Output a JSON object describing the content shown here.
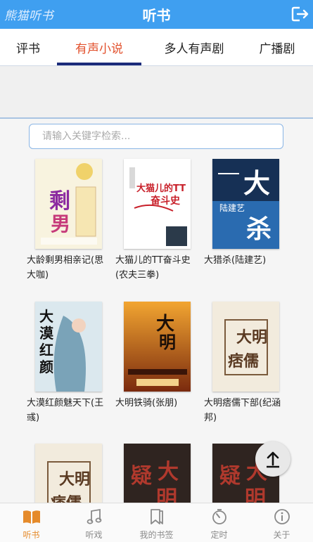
{
  "header": {
    "brand": "熊猫听书",
    "title": "听书"
  },
  "tabs": [
    {
      "label": "评书",
      "active": false
    },
    {
      "label": "有声小说",
      "active": true
    },
    {
      "label": "多人有声剧",
      "active": false
    },
    {
      "label": "广播剧",
      "active": false
    }
  ],
  "search": {
    "placeholder": "请输入关键字检索..."
  },
  "books": [
    {
      "title": "大龄剩男相亲记(思大咖)",
      "cover_text": "剩男",
      "cover_bg": "#f7f1dc"
    },
    {
      "title": "大猫儿的TT奋斗史(农夫三拳)",
      "cover_text": "大猫儿的TT奋斗史",
      "cover_bg": "#ffffff"
    },
    {
      "title": "大猎杀(陆建艺)",
      "cover_text": "大猎杀",
      "cover_bg": "#1d3f6e"
    },
    {
      "title": "大漠红颜魅天下(王彧)",
      "cover_text": "大漠红颜",
      "cover_bg": "#cfe2ea"
    },
    {
      "title": "大明铁骑(张朋)",
      "cover_text": "大明铁骑",
      "cover_bg": "#7a2e10"
    },
    {
      "title": "大明痞儒下部(纪涵邦)",
      "cover_text": "大明痞儒",
      "cover_bg": "#efe6d6"
    },
    {
      "title": "",
      "cover_text": "大明痞儒",
      "cover_bg": "#efe6d6"
    },
    {
      "title": "",
      "cover_text": "大明疑案",
      "cover_bg": "#3a2a22"
    },
    {
      "title": "",
      "cover_text": "大明疑案",
      "cover_bg": "#3a2a22"
    }
  ],
  "bottom_nav": [
    {
      "label": "听书",
      "icon": "book-open-icon",
      "active": true
    },
    {
      "label": "听戏",
      "icon": "music-note-icon",
      "active": false
    },
    {
      "label": "我的书签",
      "icon": "bookmark-icon",
      "active": false
    },
    {
      "label": "定时",
      "icon": "timer-icon",
      "active": false
    },
    {
      "label": "关于",
      "icon": "info-icon",
      "active": false
    }
  ],
  "colors": {
    "header": "#3f9ff0",
    "active_tab": "#e2502c",
    "active_nav": "#e58a2a"
  }
}
